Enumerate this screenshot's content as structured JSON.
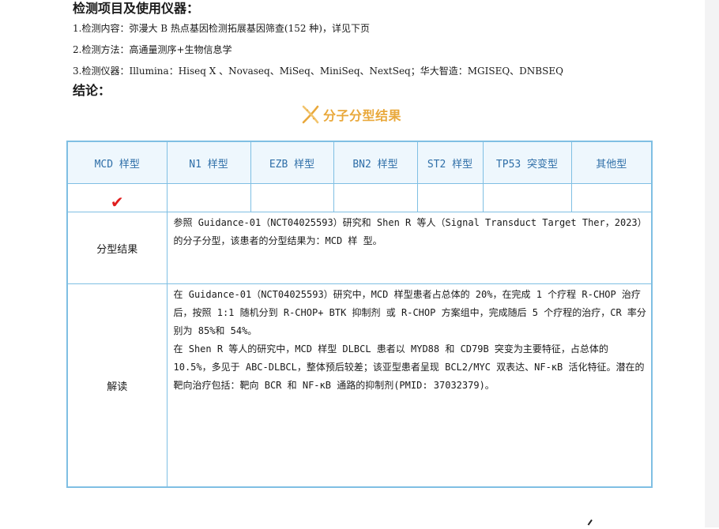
{
  "heading": "检测项目及使用仪器：",
  "items": [
    "1.检测内容：弥漫大 B 热点基因检测拓展基因筛查(152 种)，详见下页",
    "2.检测方法：高通量测序+生物信息学",
    "3.检测仪器：Illumina：Hiseq X 、Novaseq、MiSeq、MiniSeq、NextSeq；华大智造：MGISEQ、DNBSEQ"
  ],
  "conclusion_heading": "结论：",
  "section_title": "分子分型结果",
  "table": {
    "headers": [
      "MCD 样型",
      "N1 样型",
      "EZB 样型",
      "BN2 样型",
      "ST2 样型",
      "TP53 突变型",
      "其他型"
    ],
    "check_mark": "✔",
    "result_label": "分型结果",
    "result_text": "参照 Guidance-01（NCT04025593）研究和 Shen R 等人（Signal Transduct Target Ther，2023）的分子分型，该患者的分型结果为：MCD 样 型。",
    "interp_label": "解读",
    "interp_p1": "在 Guidance-01（NCT04025593）研究中，MCD 样型患者占总体的 20%，在完成 1 个疗程 R-CHOP 治疗后，按照 1:1 随机分到 R-CHOP+ BTK 抑制剂 或 R-CHOP 方案组中，完成随后 5 个疗程的治疗，CR 率分别为 85%和 54%。",
    "interp_p2": "在 Shen R 等人的研究中，MCD 样型 DLBCL 患者以 MYD88 和 CD79B 突变为主要特征，占总体的 10.5%，多见于 ABC-DLBCL，整体预后较差；该亚型患者呈现 BCL2/MYC 双表达、NF-κB 活化特征。潜在的靶向治疗包括：靶向 BCR 和 NF-κB 通路的抑制剂(PMID: 37032379)。"
  },
  "colors": {
    "accent": "#e9a83b",
    "table_border": "#7fbfe3",
    "header_text": "#2f6fa8",
    "check": "#e01e1e"
  }
}
